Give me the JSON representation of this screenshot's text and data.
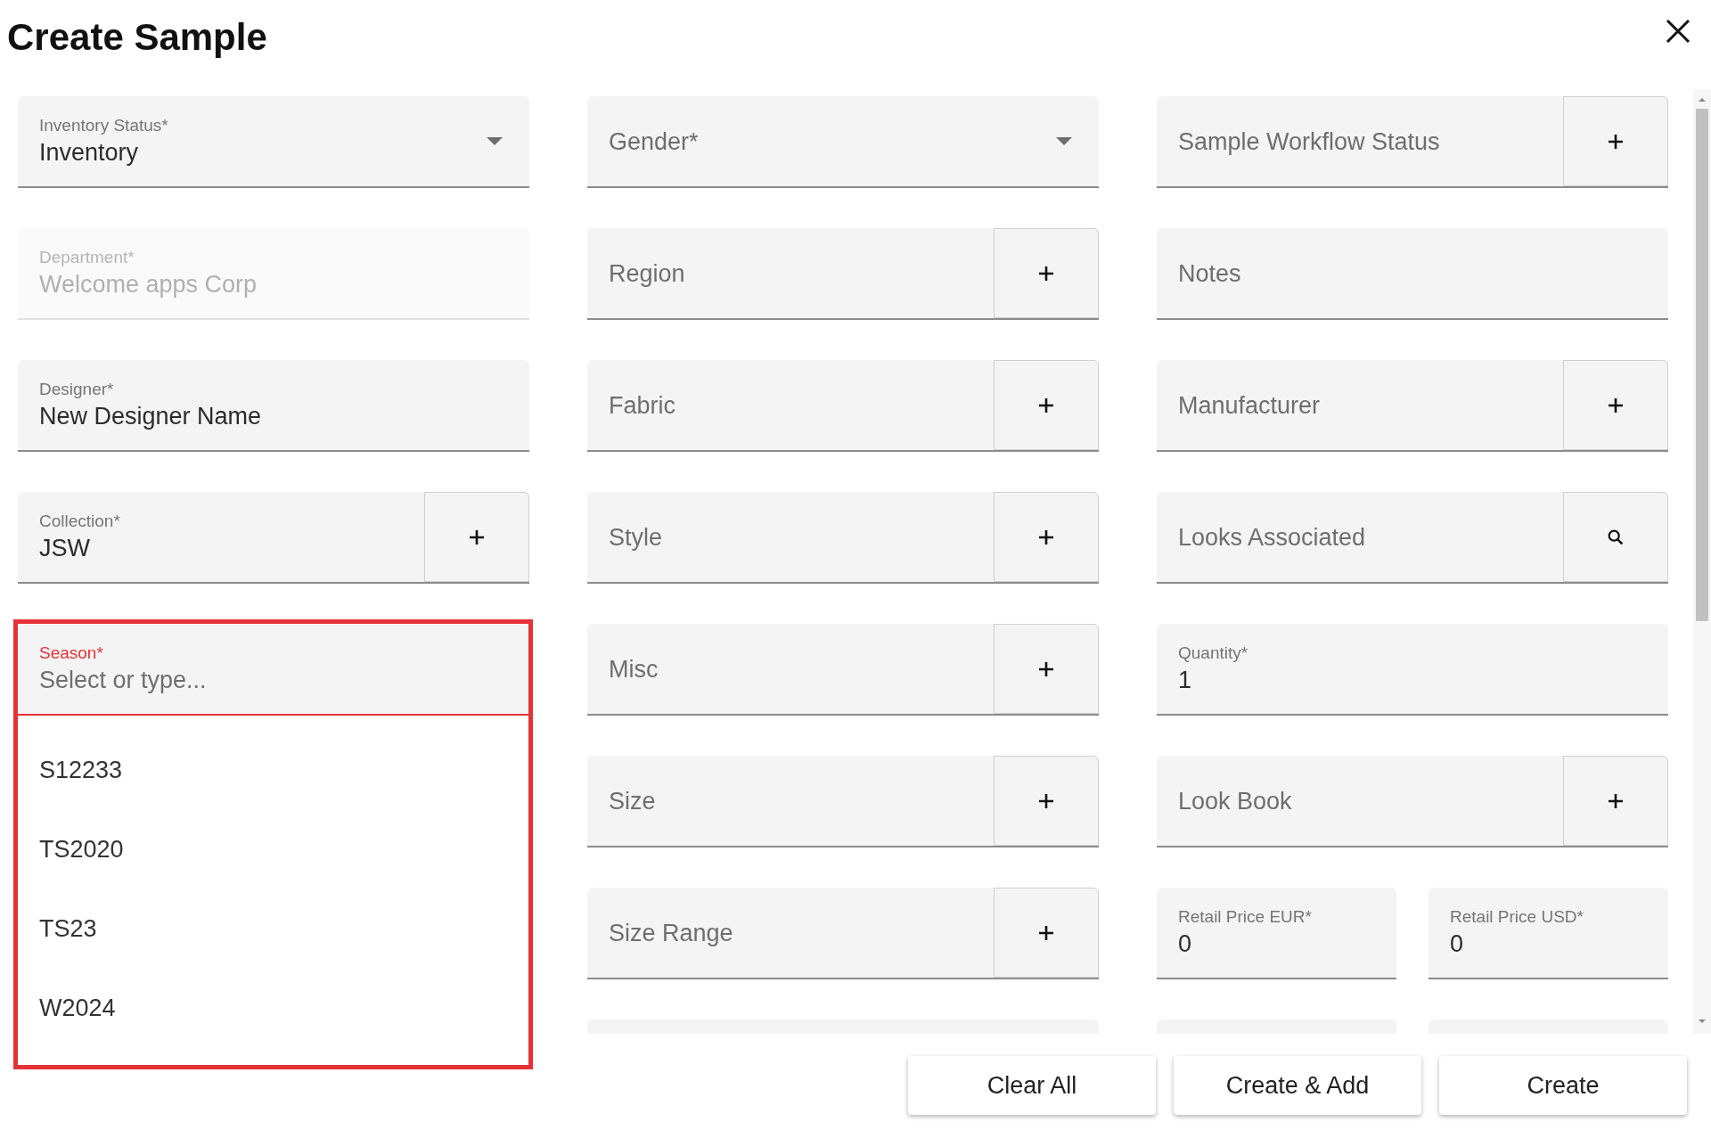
{
  "title": "Create Sample",
  "columns": [
    [
      {
        "kind": "select",
        "label": "Inventory Status*",
        "value": "Inventory",
        "disabled": false,
        "focused": false
      },
      {
        "kind": "plain",
        "label": "Department*",
        "value": "Welcome apps Corp",
        "disabled": true,
        "focused": false
      },
      {
        "kind": "plain",
        "label": "Designer*",
        "value": "New Designer Name",
        "disabled": false,
        "focused": false
      },
      {
        "kind": "add",
        "label": "Collection*",
        "value": "JSW",
        "disabled": false,
        "focused": false
      },
      {
        "kind": "combo",
        "label": "Season*",
        "placeholder": "Select or type...",
        "disabled": false,
        "focused": true,
        "options": [
          "S12233",
          "TS2020",
          "TS23",
          "W2024"
        ]
      }
    ],
    [
      {
        "kind": "select",
        "placeholder": "Gender*",
        "disabled": false,
        "focused": false
      },
      {
        "kind": "add",
        "placeholder": "Region",
        "disabled": false,
        "focused": false
      },
      {
        "kind": "add",
        "placeholder": "Fabric",
        "disabled": false,
        "focused": false
      },
      {
        "kind": "add",
        "placeholder": "Style",
        "disabled": false,
        "focused": false
      },
      {
        "kind": "add",
        "placeholder": "Misc",
        "disabled": false,
        "focused": false
      },
      {
        "kind": "add",
        "placeholder": "Size",
        "disabled": false,
        "focused": false
      },
      {
        "kind": "add",
        "placeholder": "Size Range",
        "disabled": false,
        "focused": false
      }
    ],
    [
      {
        "kind": "add",
        "placeholder": "Sample Workflow Status",
        "disabled": false,
        "focused": false
      },
      {
        "kind": "plain",
        "placeholder": "Notes",
        "disabled": false,
        "focused": false
      },
      {
        "kind": "add",
        "placeholder": "Manufacturer",
        "disabled": false,
        "focused": false
      },
      {
        "kind": "search",
        "placeholder": "Looks Associated",
        "disabled": false,
        "focused": false
      },
      {
        "kind": "plain",
        "label": "Quantity*",
        "value": "1",
        "disabled": false,
        "focused": false
      },
      {
        "kind": "add",
        "placeholder": "Look Book",
        "disabled": false,
        "focused": false
      },
      {
        "kind": "pair",
        "fields": [
          {
            "label": "Retail Price EUR*",
            "value": "0",
            "disabled": false,
            "focused": false
          },
          {
            "label": "Retail Price USD*",
            "value": "0",
            "disabled": false,
            "focused": false
          }
        ]
      }
    ]
  ],
  "buttons": [
    "Clear All",
    "Create & Add",
    "Create"
  ]
}
